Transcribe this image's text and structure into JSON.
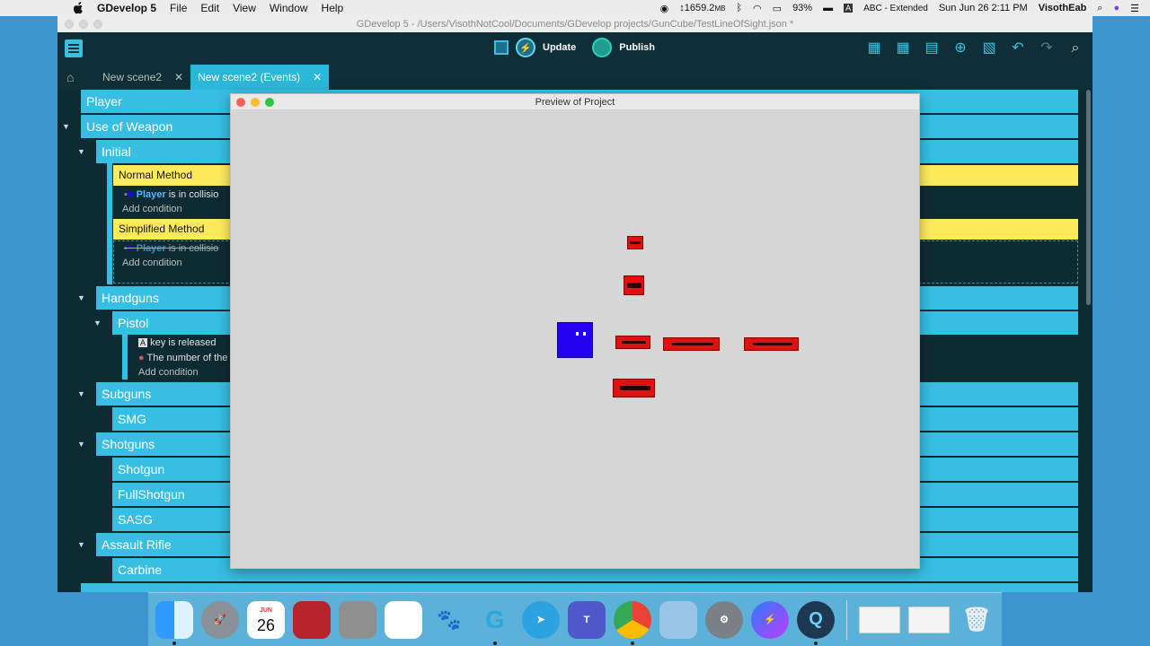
{
  "menubar": {
    "app_name": "GDevelop 5",
    "menus": [
      "File",
      "Edit",
      "View",
      "Window",
      "Help"
    ],
    "memory": "1659.2",
    "memory_unit": "MB",
    "battery": "93%",
    "input_source": "ABC - Extended",
    "datetime": "Sun Jun 26  2:11 PM",
    "user": "VisothEab"
  },
  "window": {
    "title": "GDevelop 5 - /Users/VisothNotCool/Documents/GDevelop projects/GunCube/TestLineOfSight.json *"
  },
  "toolbar": {
    "update_label": "Update",
    "publish_label": "Publish"
  },
  "tabs": [
    {
      "label": "New scene2",
      "active": false
    },
    {
      "label": "New scene2 (Events)",
      "active": true
    }
  ],
  "events": {
    "player": "Player",
    "use_of_weapon": "Use of Weapon",
    "initial": "Initial",
    "normal_method": "Normal Method",
    "normal_cond_obj": "Player",
    "normal_cond_text": " is in collisio",
    "add_condition": "Add condition",
    "simplified_method": "Simplified Method",
    "simplified_cond_obj": "Player",
    "simplified_cond_text": " is in collisio",
    "handguns": "Handguns",
    "pistol": "Pistol",
    "pistol_cond1": "key is released",
    "pistol_cond2": "The number of the",
    "subguns": "Subguns",
    "smg": "SMG",
    "shotguns": "Shotguns",
    "shotgun": "Shotgun",
    "fullshotgun": "FullShotgun",
    "sasg": "SASG",
    "assault_rifle": "Assault Rifle",
    "carbine": "Carbine"
  },
  "preview": {
    "title": "Preview of Project"
  },
  "dock": {
    "calendar_month": "JUN",
    "calendar_day": "26"
  },
  "colors": {
    "event_blue": "#36bfe3",
    "comment_yellow": "#ffea5c",
    "app_bg": "#0d2b33",
    "player_blue": "#2400f0",
    "weapon_red": "#e0110f"
  }
}
